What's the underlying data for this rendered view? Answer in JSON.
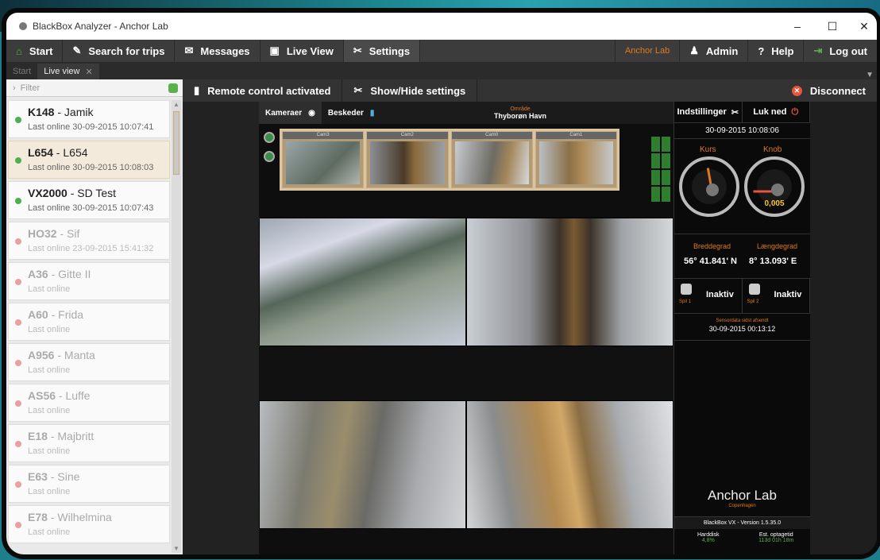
{
  "window": {
    "title": "BlackBox Analyzer - Anchor Lab"
  },
  "nav": {
    "start": "Start",
    "search": "Search for trips",
    "messages": "Messages",
    "live_view": "Live View",
    "settings": "Settings",
    "org": "Anchor Lab",
    "admin": "Admin",
    "help": "Help",
    "logout": "Log out"
  },
  "tabs": {
    "start": "Start",
    "live": "Live view"
  },
  "sidebar": {
    "filter_placeholder": "Filter",
    "vessels": [
      {
        "code": "K148",
        "name": "Jamik",
        "status": "Last online 30-09-2015 10:07:41",
        "online": true
      },
      {
        "code": "L654",
        "name": "L654",
        "status": "Last online 30-09-2015 10:08:03",
        "online": true
      },
      {
        "code": "VX2000",
        "name": "SD Test",
        "status": "Last online 30-09-2015 10:07:43",
        "online": true
      },
      {
        "code": "HO32",
        "name": "Sif",
        "status": "Last online 23-09-2015 15:41:32",
        "online": false
      },
      {
        "code": "A36",
        "name": "Gitte II",
        "status": "Last online",
        "online": false
      },
      {
        "code": "A60",
        "name": "Frida",
        "status": "Last online",
        "online": false
      },
      {
        "code": "A956",
        "name": "Manta",
        "status": "Last online",
        "online": false
      },
      {
        "code": "AS56",
        "name": "Luffe",
        "status": "Last online",
        "online": false
      },
      {
        "code": "E18",
        "name": "Majbritt",
        "status": "Last online",
        "online": false
      },
      {
        "code": "E63",
        "name": "Sine",
        "status": "Last online",
        "online": false
      },
      {
        "code": "E78",
        "name": "Wilhelmina",
        "status": "Last online",
        "online": false
      }
    ]
  },
  "toolbar": {
    "remote": "Remote control activated",
    "show_hide": "Show/Hide settings",
    "disconnect": "Disconnect"
  },
  "viewer": {
    "tab_cameras": "Kameraer",
    "tab_messages": "Beskeder",
    "area_label": "Område",
    "area_value": "Thyborøn Havn",
    "thumbs": [
      "Cam3",
      "Cam2",
      "Cam0",
      "Cam1"
    ]
  },
  "panel": {
    "settings": "Indstillinger",
    "shutdown": "Luk ned",
    "datetime": "30-09-2015  10:08:06",
    "course_label": "Kurs",
    "knots_label": "Knob",
    "knots_value": "0,005",
    "lat_label": "Breddegrad",
    "lat_value": "56° 41.841' N",
    "lon_label": "Længdegrad",
    "lon_value": "8° 13.093' E",
    "spil1_label": "Spil 1",
    "spil1_value": "Inaktiv",
    "spil2_label": "Spil 2",
    "spil2_value": "Inaktiv",
    "sensor_label": "Sensordata sidst afsendt",
    "sensor_value": "30-09-2015 00:13:12",
    "brand": "Anchor Lab",
    "brand_sub": "Copenhagen",
    "version": "BlackBox VX - Version 1.5.35.0",
    "disk_label": "Harddisk",
    "disk_value": "4,8%",
    "rec_label": "Est. optagetid",
    "rec_value": "113d 01h 18m"
  },
  "colors": {
    "accent": "#e07a1c",
    "online": "#4caf50",
    "offline": "#e8a0a0"
  }
}
